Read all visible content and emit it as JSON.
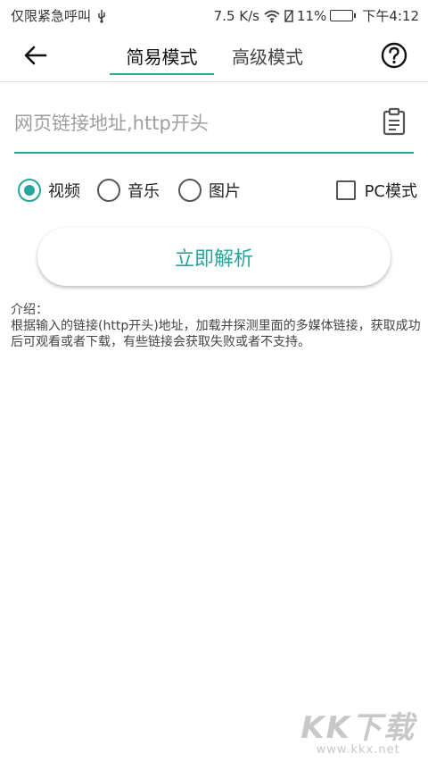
{
  "status_bar": {
    "left_text": "仅限紧急呼叫",
    "speed": "7.5 K/s",
    "battery": "11%",
    "time": "下午4:12"
  },
  "app_bar": {
    "tabs": [
      {
        "label": "简易模式",
        "active": true
      },
      {
        "label": "高级模式",
        "active": false
      }
    ]
  },
  "url_field": {
    "value": "",
    "placeholder": "网页链接地址,http开头"
  },
  "options": {
    "radios": [
      {
        "label": "视频",
        "checked": true
      },
      {
        "label": "音乐",
        "checked": false
      },
      {
        "label": "图片",
        "checked": false
      }
    ],
    "pc_mode": {
      "label": "PC模式",
      "checked": false
    }
  },
  "parse_button": {
    "label": "立即解析"
  },
  "intro": {
    "title": "介绍：",
    "body": "根据输入的链接(http开头)地址，加载并探测里面的多媒体链接，获取成功后可观看或者下载，有些链接会获取失败或者不支持。"
  },
  "watermark": {
    "logo": "KK下载",
    "url": "www.kkx.net"
  },
  "colors": {
    "accent": "#26a69a",
    "text": "#222222",
    "placeholder": "#9e9e9e"
  }
}
